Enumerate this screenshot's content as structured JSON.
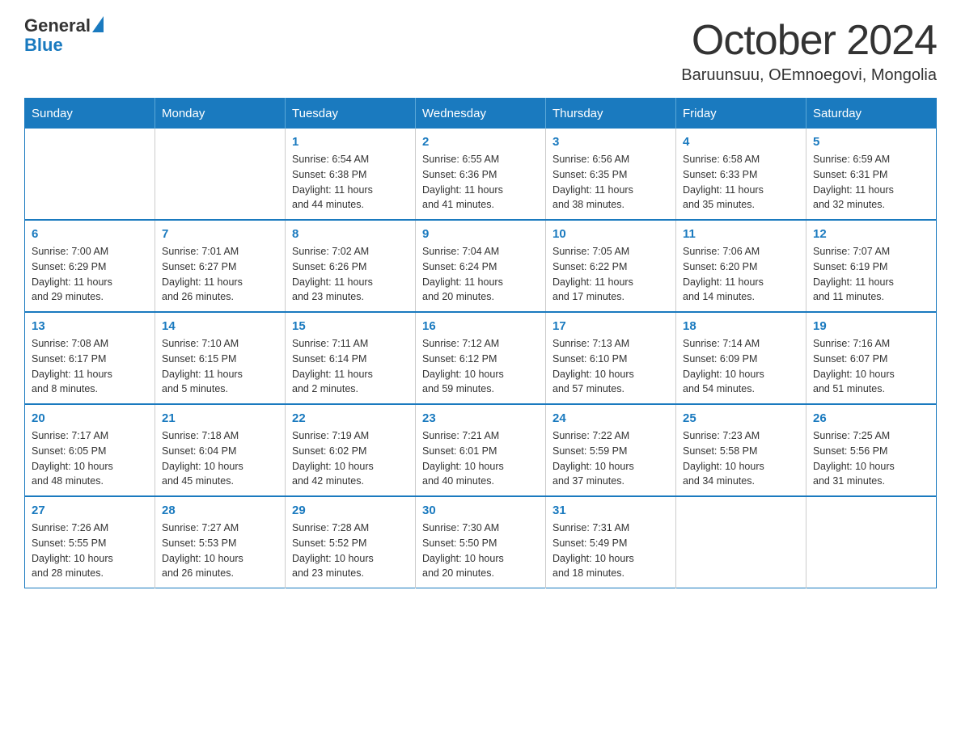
{
  "logo": {
    "text_general": "General",
    "text_blue": "Blue"
  },
  "header": {
    "month": "October 2024",
    "location": "Baruunsuu, OEmnoegovi, Mongolia"
  },
  "weekdays": [
    "Sunday",
    "Monday",
    "Tuesday",
    "Wednesday",
    "Thursday",
    "Friday",
    "Saturday"
  ],
  "weeks": [
    [
      {
        "day": "",
        "info": ""
      },
      {
        "day": "",
        "info": ""
      },
      {
        "day": "1",
        "info": "Sunrise: 6:54 AM\nSunset: 6:38 PM\nDaylight: 11 hours\nand 44 minutes."
      },
      {
        "day": "2",
        "info": "Sunrise: 6:55 AM\nSunset: 6:36 PM\nDaylight: 11 hours\nand 41 minutes."
      },
      {
        "day": "3",
        "info": "Sunrise: 6:56 AM\nSunset: 6:35 PM\nDaylight: 11 hours\nand 38 minutes."
      },
      {
        "day": "4",
        "info": "Sunrise: 6:58 AM\nSunset: 6:33 PM\nDaylight: 11 hours\nand 35 minutes."
      },
      {
        "day": "5",
        "info": "Sunrise: 6:59 AM\nSunset: 6:31 PM\nDaylight: 11 hours\nand 32 minutes."
      }
    ],
    [
      {
        "day": "6",
        "info": "Sunrise: 7:00 AM\nSunset: 6:29 PM\nDaylight: 11 hours\nand 29 minutes."
      },
      {
        "day": "7",
        "info": "Sunrise: 7:01 AM\nSunset: 6:27 PM\nDaylight: 11 hours\nand 26 minutes."
      },
      {
        "day": "8",
        "info": "Sunrise: 7:02 AM\nSunset: 6:26 PM\nDaylight: 11 hours\nand 23 minutes."
      },
      {
        "day": "9",
        "info": "Sunrise: 7:04 AM\nSunset: 6:24 PM\nDaylight: 11 hours\nand 20 minutes."
      },
      {
        "day": "10",
        "info": "Sunrise: 7:05 AM\nSunset: 6:22 PM\nDaylight: 11 hours\nand 17 minutes."
      },
      {
        "day": "11",
        "info": "Sunrise: 7:06 AM\nSunset: 6:20 PM\nDaylight: 11 hours\nand 14 minutes."
      },
      {
        "day": "12",
        "info": "Sunrise: 7:07 AM\nSunset: 6:19 PM\nDaylight: 11 hours\nand 11 minutes."
      }
    ],
    [
      {
        "day": "13",
        "info": "Sunrise: 7:08 AM\nSunset: 6:17 PM\nDaylight: 11 hours\nand 8 minutes."
      },
      {
        "day": "14",
        "info": "Sunrise: 7:10 AM\nSunset: 6:15 PM\nDaylight: 11 hours\nand 5 minutes."
      },
      {
        "day": "15",
        "info": "Sunrise: 7:11 AM\nSunset: 6:14 PM\nDaylight: 11 hours\nand 2 minutes."
      },
      {
        "day": "16",
        "info": "Sunrise: 7:12 AM\nSunset: 6:12 PM\nDaylight: 10 hours\nand 59 minutes."
      },
      {
        "day": "17",
        "info": "Sunrise: 7:13 AM\nSunset: 6:10 PM\nDaylight: 10 hours\nand 57 minutes."
      },
      {
        "day": "18",
        "info": "Sunrise: 7:14 AM\nSunset: 6:09 PM\nDaylight: 10 hours\nand 54 minutes."
      },
      {
        "day": "19",
        "info": "Sunrise: 7:16 AM\nSunset: 6:07 PM\nDaylight: 10 hours\nand 51 minutes."
      }
    ],
    [
      {
        "day": "20",
        "info": "Sunrise: 7:17 AM\nSunset: 6:05 PM\nDaylight: 10 hours\nand 48 minutes."
      },
      {
        "day": "21",
        "info": "Sunrise: 7:18 AM\nSunset: 6:04 PM\nDaylight: 10 hours\nand 45 minutes."
      },
      {
        "day": "22",
        "info": "Sunrise: 7:19 AM\nSunset: 6:02 PM\nDaylight: 10 hours\nand 42 minutes."
      },
      {
        "day": "23",
        "info": "Sunrise: 7:21 AM\nSunset: 6:01 PM\nDaylight: 10 hours\nand 40 minutes."
      },
      {
        "day": "24",
        "info": "Sunrise: 7:22 AM\nSunset: 5:59 PM\nDaylight: 10 hours\nand 37 minutes."
      },
      {
        "day": "25",
        "info": "Sunrise: 7:23 AM\nSunset: 5:58 PM\nDaylight: 10 hours\nand 34 minutes."
      },
      {
        "day": "26",
        "info": "Sunrise: 7:25 AM\nSunset: 5:56 PM\nDaylight: 10 hours\nand 31 minutes."
      }
    ],
    [
      {
        "day": "27",
        "info": "Sunrise: 7:26 AM\nSunset: 5:55 PM\nDaylight: 10 hours\nand 28 minutes."
      },
      {
        "day": "28",
        "info": "Sunrise: 7:27 AM\nSunset: 5:53 PM\nDaylight: 10 hours\nand 26 minutes."
      },
      {
        "day": "29",
        "info": "Sunrise: 7:28 AM\nSunset: 5:52 PM\nDaylight: 10 hours\nand 23 minutes."
      },
      {
        "day": "30",
        "info": "Sunrise: 7:30 AM\nSunset: 5:50 PM\nDaylight: 10 hours\nand 20 minutes."
      },
      {
        "day": "31",
        "info": "Sunrise: 7:31 AM\nSunset: 5:49 PM\nDaylight: 10 hours\nand 18 minutes."
      },
      {
        "day": "",
        "info": ""
      },
      {
        "day": "",
        "info": ""
      }
    ]
  ]
}
